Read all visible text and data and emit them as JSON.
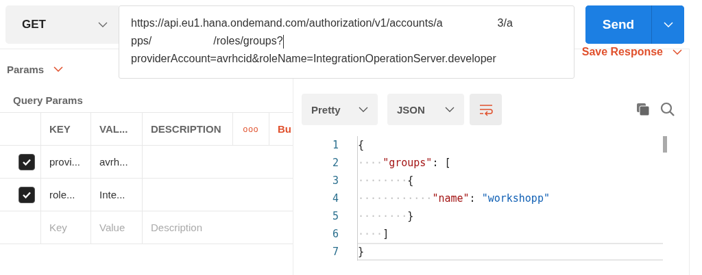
{
  "request": {
    "method": "GET",
    "url_lines": [
      [
        {
          "kind": "text",
          "text": "https://api.eu1.hana.ondemand.com/authorization/v1/accounts/a"
        },
        {
          "kind": "redacted"
        },
        {
          "kind": "text",
          "text": "3/a"
        }
      ],
      [
        {
          "kind": "text",
          "text": "pps/"
        },
        {
          "kind": "redacted"
        },
        {
          "kind": "text",
          "text": "/roles/groups?"
        }
      ],
      [
        {
          "kind": "text",
          "text": "providerAccount=avrhcid&roleName=IntegrationOperationServer.developer"
        }
      ]
    ],
    "send": "Send"
  },
  "tabs": [
    {
      "label": "Params",
      "selected": true
    }
  ],
  "save_response": "Save Response",
  "query_params": {
    "title": "Query Params",
    "columns": [
      "KEY",
      "VAL...",
      "DESCRIPTION"
    ],
    "more": "ooo",
    "bulk": "Bu",
    "rows": [
      {
        "checked": true,
        "key": "provi...",
        "value": "avrh..."
      },
      {
        "checked": true,
        "key": "role...",
        "value": "Inte..."
      }
    ],
    "placeholders": {
      "key": "Key",
      "value": "Value",
      "description": "Description"
    }
  },
  "response": {
    "format": "Pretty",
    "language": "JSON",
    "code": [
      {
        "number": "1",
        "tokens": [
          {
            "kind": "punct",
            "text": "{"
          }
        ]
      },
      {
        "number": "2",
        "tokens": [
          {
            "kind": "ws",
            "text": "····"
          },
          {
            "kind": "key",
            "text": "\"groups\""
          },
          {
            "kind": "punct",
            "text": ": ["
          }
        ]
      },
      {
        "number": "3",
        "tokens": [
          {
            "kind": "ws",
            "text": "········"
          },
          {
            "kind": "punct",
            "text": "{"
          }
        ]
      },
      {
        "number": "4",
        "tokens": [
          {
            "kind": "ws",
            "text": "············"
          },
          {
            "kind": "key",
            "text": "\"name\""
          },
          {
            "kind": "punct",
            "text": ": "
          },
          {
            "kind": "string",
            "text": "\"workshopp\""
          }
        ]
      },
      {
        "number": "5",
        "tokens": [
          {
            "kind": "ws",
            "text": "········"
          },
          {
            "kind": "punct",
            "text": "}"
          }
        ]
      },
      {
        "number": "6",
        "tokens": [
          {
            "kind": "ws",
            "text": "····"
          },
          {
            "kind": "punct",
            "text": "]"
          }
        ]
      },
      {
        "number": "7",
        "tokens": [
          {
            "kind": "punct",
            "text": "}"
          }
        ]
      }
    ]
  }
}
